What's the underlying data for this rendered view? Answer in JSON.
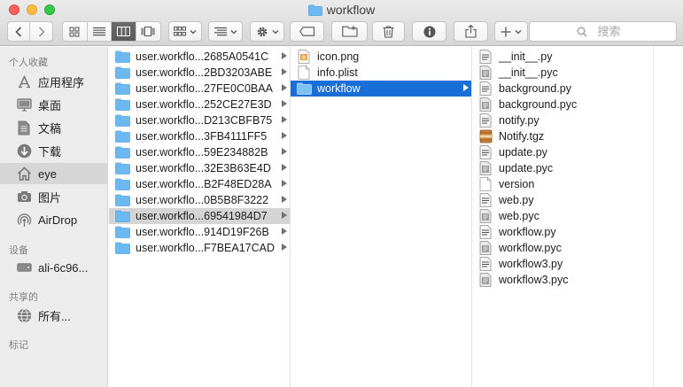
{
  "window": {
    "title": "workflow"
  },
  "toolbar": {
    "search_placeholder": "搜索"
  },
  "sidebar": {
    "favorites_header": "个人收藏",
    "devices_header": "设备",
    "shared_header": "共享的",
    "tags_header": "标记",
    "favorites": [
      {
        "label": "应用程序",
        "icon": "applications-icon"
      },
      {
        "label": "桌面",
        "icon": "desktop-icon"
      },
      {
        "label": "文稿",
        "icon": "documents-icon"
      },
      {
        "label": "下载",
        "icon": "downloads-icon"
      },
      {
        "label": "eye",
        "icon": "home-icon"
      },
      {
        "label": "图片",
        "icon": "pictures-icon"
      },
      {
        "label": "AirDrop",
        "icon": "airdrop-icon"
      }
    ],
    "devices": [
      {
        "label": "ali-6c96...",
        "icon": "drive-icon"
      }
    ],
    "shared": [
      {
        "label": "所有...",
        "icon": "network-icon"
      }
    ]
  },
  "column1": {
    "items": [
      "user.workflo...2685A0541C",
      "user.workflo...2BD3203ABE",
      "user.workflo...27FE0C0BAA",
      "user.workflo...252CE27E3D",
      "user.workflo...D213CBFB75",
      "user.workflo...3FB4111FF5",
      "user.workflo...59E234882B",
      "user.workflo...32E3B63E4D",
      "user.workflo...B2F48ED28A",
      "user.workflo...0B5B8F3222",
      "user.workflo...69541984D7",
      "user.workflo...914D19F26B",
      "user.workflo...F7BEA17CAD"
    ]
  },
  "column2": {
    "items": [
      {
        "label": "icon.png",
        "icon": "image-file-icon"
      },
      {
        "label": "info.plist",
        "icon": "document-icon"
      },
      {
        "label": "workflow",
        "icon": "folder-icon"
      }
    ]
  },
  "column3": {
    "items": [
      {
        "label": "__init__.py",
        "icon": "script-file-icon"
      },
      {
        "label": "__init__.pyc",
        "icon": "compiled-file-icon"
      },
      {
        "label": "background.py",
        "icon": "script-file-icon"
      },
      {
        "label": "background.pyc",
        "icon": "compiled-file-icon"
      },
      {
        "label": "notify.py",
        "icon": "script-file-icon"
      },
      {
        "label": "Notify.tgz",
        "icon": "archive-icon"
      },
      {
        "label": "update.py",
        "icon": "script-file-icon"
      },
      {
        "label": "update.pyc",
        "icon": "compiled-file-icon"
      },
      {
        "label": "version",
        "icon": "document-icon"
      },
      {
        "label": "web.py",
        "icon": "script-file-icon"
      },
      {
        "label": "web.pyc",
        "icon": "compiled-file-icon"
      },
      {
        "label": "workflow.py",
        "icon": "script-file-icon"
      },
      {
        "label": "workflow.pyc",
        "icon": "compiled-file-icon"
      },
      {
        "label": "workflow3.py",
        "icon": "script-file-icon"
      },
      {
        "label": "workflow3.pyc",
        "icon": "compiled-file-icon"
      }
    ]
  },
  "colors": {
    "selection_blue": "#1a6ed8",
    "folder_blue": "#6cb8f0"
  }
}
